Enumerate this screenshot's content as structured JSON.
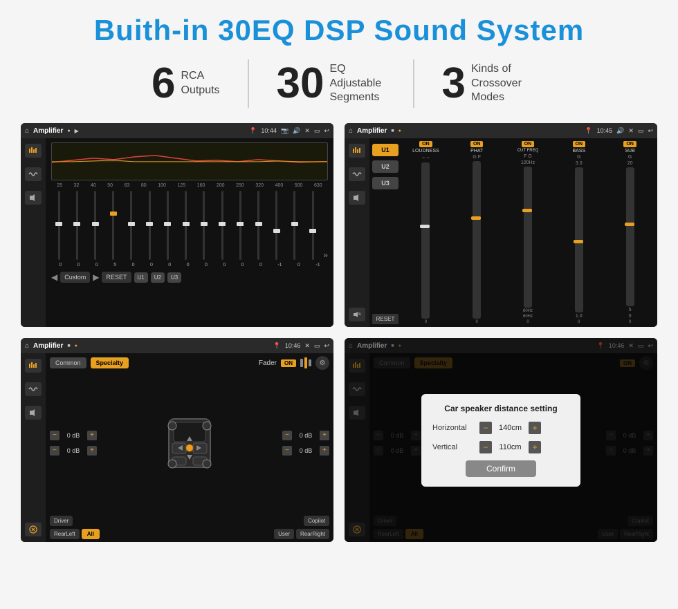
{
  "title": "Buith-in 30EQ DSP Sound System",
  "stats": [
    {
      "number": "6",
      "label_line1": "RCA",
      "label_line2": "Outputs"
    },
    {
      "number": "30",
      "label_line1": "EQ Adjustable",
      "label_line2": "Segments"
    },
    {
      "number": "3",
      "label_line1": "Kinds of",
      "label_line2": "Crossover Modes"
    }
  ],
  "screen1": {
    "title": "Amplifier",
    "time": "10:44",
    "eq_freqs": [
      "25",
      "32",
      "40",
      "50",
      "63",
      "80",
      "100",
      "125",
      "160",
      "200",
      "250",
      "320",
      "400",
      "500",
      "630"
    ],
    "eq_values": [
      "0",
      "0",
      "0",
      "5",
      "0",
      "0",
      "0",
      "0",
      "0",
      "0",
      "0",
      "0",
      "-1",
      "0",
      "-1"
    ],
    "bottom_labels": [
      "Custom",
      "RESET",
      "U1",
      "U2",
      "U3"
    ]
  },
  "screen2": {
    "title": "Amplifier",
    "time": "10:45",
    "u_buttons": [
      "U1",
      "U2",
      "U3"
    ],
    "channels": [
      {
        "on": true,
        "label": "LOUDNESS"
      },
      {
        "on": true,
        "label": "PHAT"
      },
      {
        "on": true,
        "label": "CUT FREQ"
      },
      {
        "on": true,
        "label": "BASS"
      },
      {
        "on": true,
        "label": "SUB"
      }
    ],
    "reset": "RESET"
  },
  "screen3": {
    "title": "Amplifier",
    "time": "10:46",
    "tabs": [
      "Common",
      "Specialty"
    ],
    "fader_label": "Fader",
    "on_label": "ON",
    "controls": [
      {
        "label": "0 dB"
      },
      {
        "label": "0 dB"
      },
      {
        "label": "0 dB"
      },
      {
        "label": "0 dB"
      }
    ],
    "bottom_buttons": [
      "Driver",
      "Copilot",
      "RearLeft",
      "All",
      "User",
      "RearRight"
    ]
  },
  "screen4": {
    "title": "Amplifier",
    "time": "10:46",
    "tabs": [
      "Common",
      "Specialty"
    ],
    "dialog": {
      "title": "Car speaker distance setting",
      "horizontal_label": "Horizontal",
      "horizontal_value": "140cm",
      "vertical_label": "Vertical",
      "vertical_value": "110cm",
      "confirm_label": "Confirm"
    },
    "bottom_buttons": [
      "Driver",
      "Copilot",
      "RearLeft",
      "All",
      "User",
      "RearRight"
    ],
    "right_db": [
      "0 dB",
      "0 dB"
    ]
  }
}
